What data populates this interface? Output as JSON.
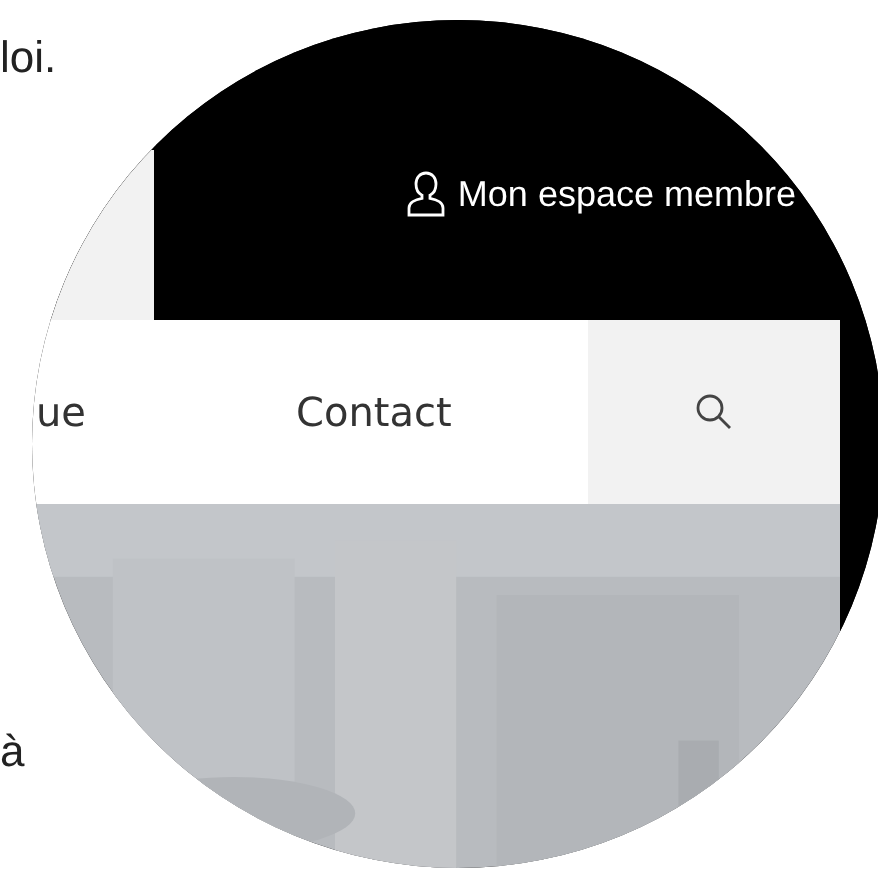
{
  "article": {
    "lines": [
      "loi.",
      "à"
    ]
  },
  "header": {
    "member_link": "Mon espace membre"
  },
  "nav": {
    "items": [
      "ue",
      "Contact"
    ]
  }
}
